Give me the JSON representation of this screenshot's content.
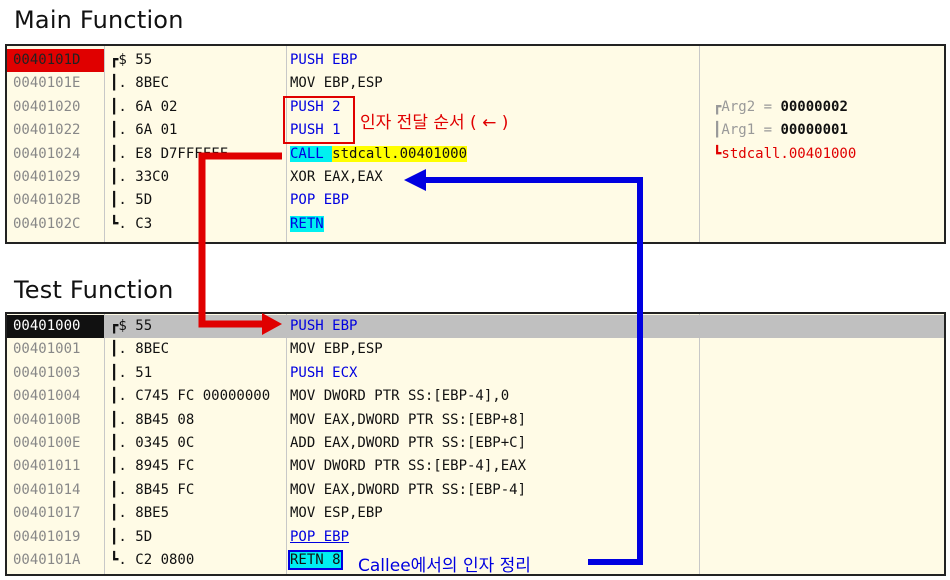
{
  "main_title": "Main Function",
  "test_title": "Test Function",
  "main_rows": [
    {
      "addr": "0040101D",
      "bytes": "┏$ 55",
      "instr": "PUSH EBP"
    },
    {
      "addr": "0040101E",
      "bytes": "┃. 8BEC",
      "instr": "MOV EBP,ESP"
    },
    {
      "addr": "00401020",
      "bytes": "┃. 6A 02",
      "instr": "PUSH 2"
    },
    {
      "addr": "00401022",
      "bytes": "┃. 6A 01",
      "instr": "PUSH 1"
    },
    {
      "addr": "00401024",
      "bytes": "┃. E8 D7FFFFFF",
      "instr": "CALL stdcall.00401000"
    },
    {
      "addr": "00401029",
      "bytes": "┃. 33C0",
      "instr": "XOR EAX,EAX"
    },
    {
      "addr": "0040102B",
      "bytes": "┃. 5D",
      "instr": "POP EBP"
    },
    {
      "addr": "0040102C",
      "bytes": "┗. C3",
      "instr": "RETN"
    }
  ],
  "main_comments": {
    "arg2_label": "┏Arg2 = ",
    "arg2_value": "00000002",
    "arg1_label": "┃Arg1 = ",
    "arg1_value": "00000001",
    "call_target": "┗stdcall.00401000"
  },
  "test_rows": [
    {
      "addr": "00401000",
      "bytes": "┏$ 55",
      "instr": "PUSH EBP"
    },
    {
      "addr": "00401001",
      "bytes": "┃. 8BEC",
      "instr": "MOV EBP,ESP"
    },
    {
      "addr": "00401003",
      "bytes": "┃. 51",
      "instr": "PUSH ECX"
    },
    {
      "addr": "00401004",
      "bytes": "┃. C745 FC 00000000",
      "instr": "MOV DWORD PTR SS:[EBP-4],0"
    },
    {
      "addr": "0040100B",
      "bytes": "┃. 8B45 08",
      "instr": "MOV EAX,DWORD PTR SS:[EBP+8]"
    },
    {
      "addr": "0040100E",
      "bytes": "┃. 0345 0C",
      "instr": "ADD EAX,DWORD PTR SS:[EBP+C]"
    },
    {
      "addr": "00401011",
      "bytes": "┃. 8945 FC",
      "instr": "MOV DWORD PTR SS:[EBP-4],EAX"
    },
    {
      "addr": "00401014",
      "bytes": "┃. 8B45 FC",
      "instr": "MOV EAX,DWORD PTR SS:[EBP-4]"
    },
    {
      "addr": "00401017",
      "bytes": "┃. 8BE5",
      "instr": "MOV ESP,EBP"
    },
    {
      "addr": "00401019",
      "bytes": "┃. 5D",
      "instr": "POP EBP"
    },
    {
      "addr": "0040101A",
      "bytes": "┗. C2 0800",
      "instr": "RETN 8"
    }
  ],
  "annotations": {
    "arg_order": "인자 전달 순서 ( ← )",
    "callee_cleanup": "Callee에서의 인자 정리"
  },
  "colors": {
    "red_arrow": "#e00000",
    "blue_arrow": "#0000e0",
    "panel_bg": "#fffbe6",
    "selected_addr_main": "#e00000",
    "selected_addr_test": "#111111"
  }
}
